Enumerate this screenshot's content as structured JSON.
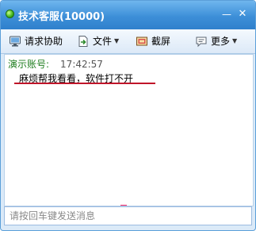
{
  "window": {
    "title": "技术客服(10000)",
    "minimize_glyph": "—",
    "close_glyph": "✕"
  },
  "toolbar": {
    "request_help": "请求协助",
    "file": "文件",
    "screenshot": "截屏",
    "more": "更多"
  },
  "chat": {
    "messages": [
      {
        "sender": "演示账号:",
        "time": "17:42:57",
        "text": "麻烦帮我看看，软件打不开"
      }
    ]
  },
  "input": {
    "placeholder": "请按回车键发送消息",
    "value": ""
  },
  "colors": {
    "title_bar": "#3d8fd8",
    "sender_name": "#1f7e1f",
    "annotation_line": "#c0152a"
  }
}
